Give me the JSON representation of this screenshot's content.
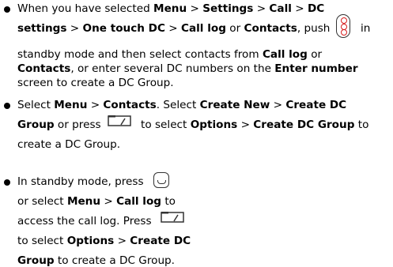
{
  "bullets": [
    {
      "lines": [
        [
          {
            "t": "When you have selected ",
            "b": false
          },
          {
            "t": "Menu",
            "b": true
          },
          {
            "t": " > ",
            "b": false
          },
          {
            "t": "Settings",
            "b": true
          },
          {
            "t": " > ",
            "b": false
          },
          {
            "t": "Call",
            "b": true
          },
          {
            "t": " > ",
            "b": false
          },
          {
            "t": "DC",
            "b": true
          }
        ],
        [
          {
            "t": "settings",
            "b": true
          },
          {
            "t": " > ",
            "b": false
          },
          {
            "t": "One touch DC",
            "b": true
          },
          {
            "t": " > ",
            "b": false
          },
          {
            "t": "Call log",
            "b": true
          },
          {
            "t": " or ",
            "b": false
          },
          {
            "t": "Contacts",
            "b": true
          },
          {
            "t": ", push",
            "b": false
          }
        ],
        [
          {
            "t": "in",
            "b": false
          }
        ],
        [
          {
            "t": "standby mode and then select contacts from ",
            "b": false
          },
          {
            "t": "Call log",
            "b": true
          },
          {
            "t": " or",
            "b": false
          }
        ],
        [
          {
            "t": "Contacts",
            "b": true
          },
          {
            "t": ", or enter several DC numbers on the ",
            "b": false
          },
          {
            "t": "Enter number",
            "b": true
          }
        ],
        [
          {
            "t": "screen to create a DC Group.",
            "b": false
          }
        ]
      ]
    },
    {
      "lines": [
        [
          {
            "t": "Select ",
            "b": false
          },
          {
            "t": "Menu",
            "b": true
          },
          {
            "t": " > ",
            "b": false
          },
          {
            "t": "Contacts",
            "b": true
          },
          {
            "t": ". Select ",
            "b": false
          },
          {
            "t": "Create New",
            "b": true
          },
          {
            "t": " > ",
            "b": false
          },
          {
            "t": "Create DC",
            "b": true
          }
        ],
        [
          {
            "t": "Group",
            "b": true
          },
          {
            "t": " or press",
            "b": false
          }
        ],
        [
          {
            "t": "to select ",
            "b": false
          },
          {
            "t": "Options",
            "b": true
          },
          {
            "t": " > ",
            "b": false
          },
          {
            "t": "Create DC Group",
            "b": true
          },
          {
            "t": " to",
            "b": false
          }
        ],
        [
          {
            "t": "create a DC Group.",
            "b": false
          }
        ]
      ]
    },
    {
      "lines": [
        [
          {
            "t": "In standby mode, press",
            "b": false
          }
        ],
        [
          {
            "t": "or select ",
            "b": false
          },
          {
            "t": "Menu",
            "b": true
          },
          {
            "t": " > ",
            "b": false
          },
          {
            "t": "Call log",
            "b": true
          },
          {
            "t": " to",
            "b": false
          }
        ],
        [
          {
            "t": "access the call log. Press",
            "b": false
          }
        ],
        [
          {
            "t": "to select ",
            "b": false
          },
          {
            "t": "Options",
            "b": true
          },
          {
            "t": " > ",
            "b": false
          },
          {
            "t": "Create DC",
            "b": true
          }
        ],
        [
          {
            "t": "Group",
            "b": true
          },
          {
            "t": " to create a DC Group.",
            "b": false
          }
        ]
      ]
    }
  ],
  "icons": [
    {
      "name": "dc-key-icon",
      "kind": "dc"
    },
    {
      "name": "left-soft-key-icon",
      "kind": "softkey"
    },
    {
      "name": "call-key-icon",
      "kind": "call"
    },
    {
      "name": "left-soft-key-icon",
      "kind": "softkey"
    }
  ]
}
